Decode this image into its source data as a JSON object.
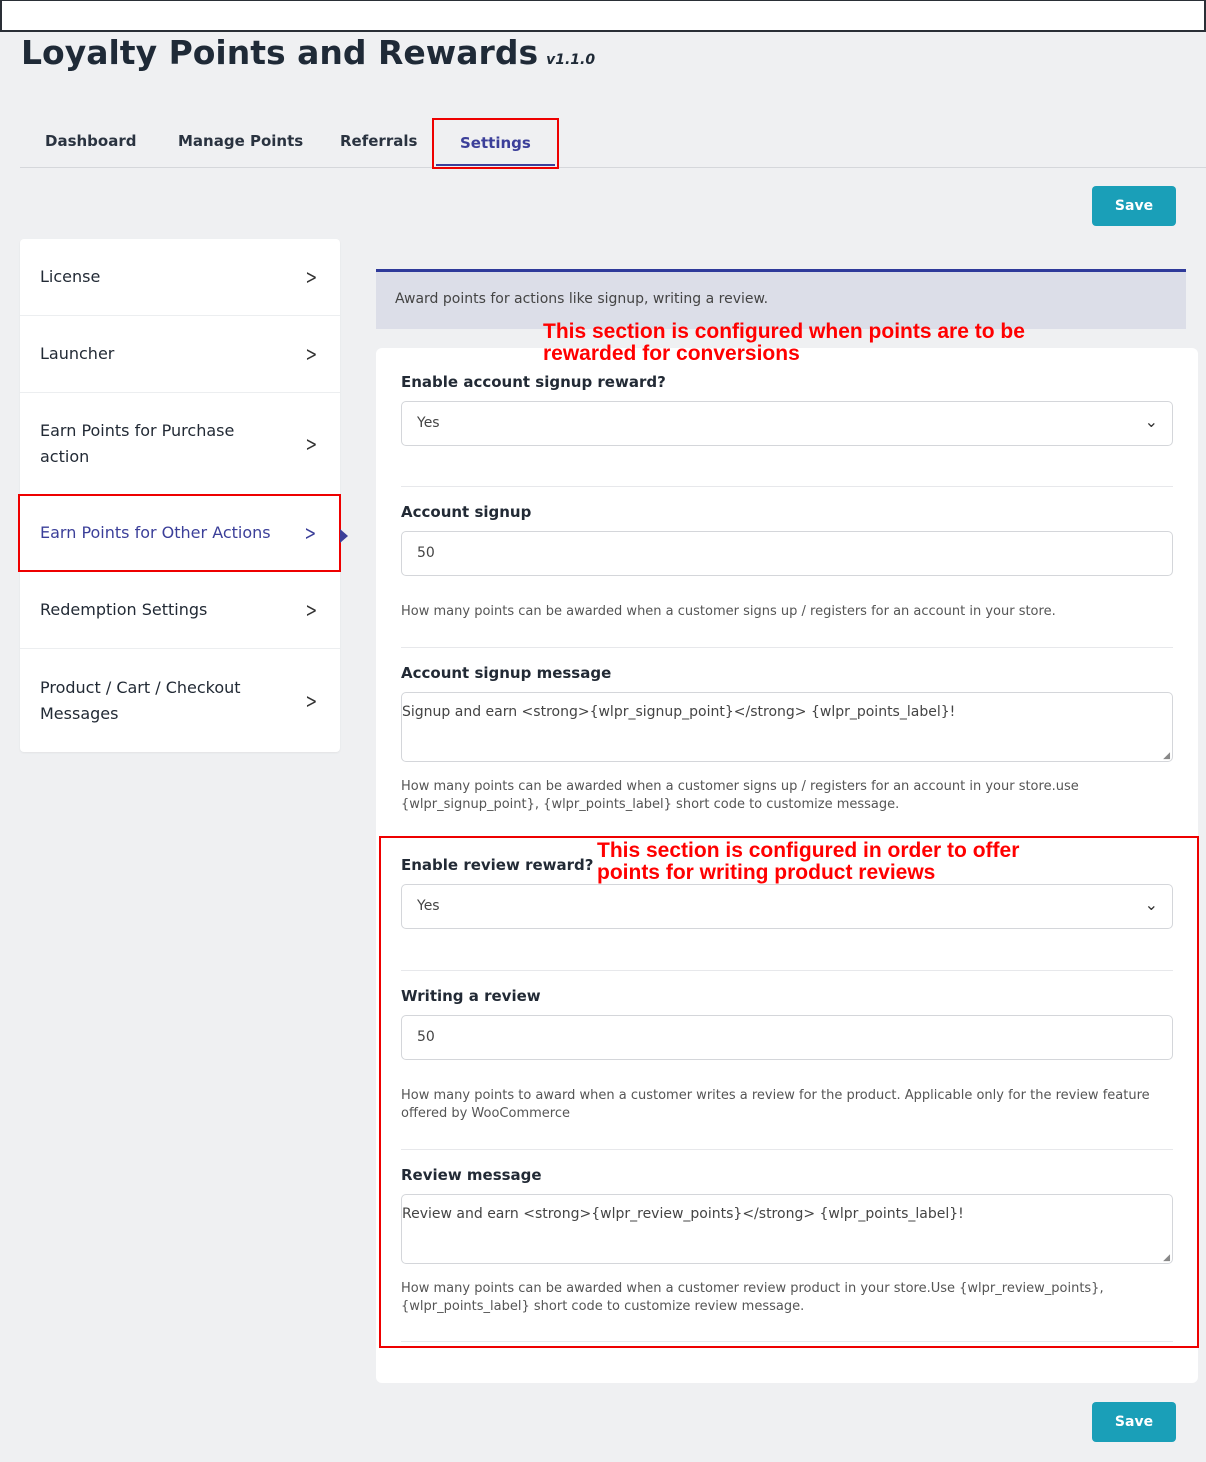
{
  "header": {
    "title": "Loyalty Points and Rewards",
    "version": "v1.1.0"
  },
  "tabs": [
    {
      "label": "Dashboard"
    },
    {
      "label": "Manage Points"
    },
    {
      "label": "Referrals"
    },
    {
      "label": "Settings",
      "active": true
    }
  ],
  "save_label": "Save",
  "sidebar": {
    "items": [
      {
        "label": "License"
      },
      {
        "label": "Launcher"
      },
      {
        "label": "Earn Points for Purchase action"
      },
      {
        "label": "Earn Points for Other Actions",
        "active": true
      },
      {
        "label": "Redemption Settings"
      },
      {
        "label": "Product / Cart / Checkout Messages"
      }
    ]
  },
  "banner": "Award points for actions like signup, writing a review.",
  "annotations": {
    "signup": "This section is configured when points are to be rewarded for conversions",
    "review": "This section is configured in order to offer points for writing product reviews"
  },
  "form": {
    "enable_signup": {
      "label": "Enable account signup reward?",
      "value": "Yes"
    },
    "signup_points": {
      "label": "Account signup",
      "value": "50",
      "help": "How many points can be awarded when a customer signs up / registers for an account in your store."
    },
    "signup_message": {
      "label": "Account signup message",
      "value": "Signup and earn <strong>{wlpr_signup_point}</strong> {wlpr_points_label}!",
      "help": "How many points can be awarded when a customer signs up / registers for an account in your store.use {wlpr_signup_point}, {wlpr_points_label} short code to customize message."
    },
    "enable_review": {
      "label": "Enable review reward?",
      "value": "Yes"
    },
    "review_points": {
      "label": "Writing a review",
      "value": "50",
      "help": "How many points to award when a customer writes a review for the product. Applicable only for the review feature offered by WooCommerce"
    },
    "review_message": {
      "label": "Review message",
      "value": "Review and earn <strong>{wlpr_review_points}</strong> {wlpr_points_label}!",
      "help": "How many points can be awarded when a customer review product in your store.Use {wlpr_review_points}, {wlpr_points_label} short code to customize review message."
    }
  },
  "colors": {
    "accent": "#3b3f99",
    "button": "#1a9fb8",
    "annotation": "#ff0000"
  }
}
